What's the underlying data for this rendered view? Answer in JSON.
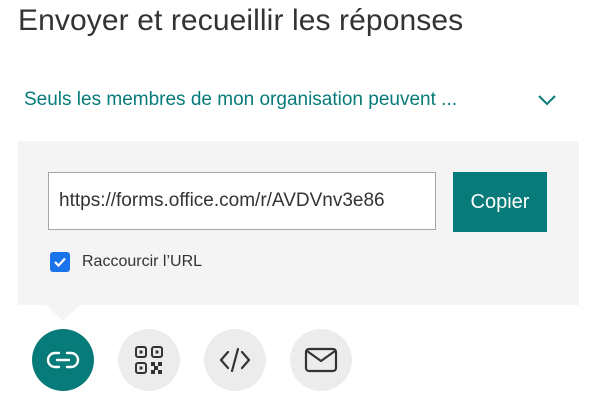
{
  "header": {
    "title": "Envoyer et recueillir les réponses"
  },
  "permission": {
    "label": "Seuls les membres de mon organisation peuvent ..."
  },
  "link_panel": {
    "url": "https://forms.office.com/r/AVDVnv3e86",
    "copy_label": "Copier",
    "shorten_label": "Raccourcir l’URL",
    "shorten_checked": true
  },
  "share_options": [
    {
      "icon": "link-icon",
      "selected": true
    },
    {
      "icon": "qr-code-icon",
      "selected": false
    },
    {
      "icon": "embed-code-icon",
      "selected": false
    },
    {
      "icon": "mail-icon",
      "selected": false
    }
  ],
  "colors": {
    "accent": "#077a7a",
    "checkbox": "#1a73e8",
    "panel": "#f4f4f4",
    "circle": "#ececec"
  }
}
